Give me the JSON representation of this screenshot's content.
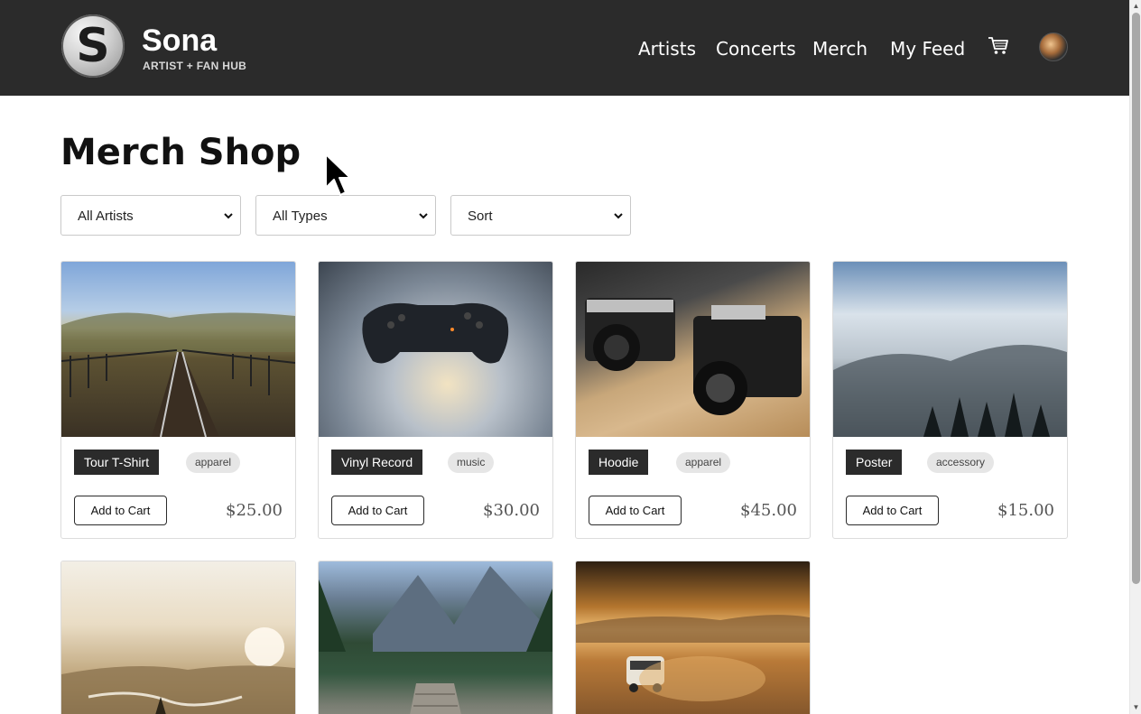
{
  "header": {
    "logo_letter": "S",
    "brand_name": "Sona",
    "brand_tagline": "ARTIST + FAN HUB",
    "nav": [
      {
        "label": "Artists"
      },
      {
        "label": "Concerts"
      },
      {
        "label": "Merch"
      },
      {
        "label": "My Feed"
      }
    ],
    "cart_icon": "cart-icon",
    "avatar_icon": "avatar"
  },
  "main": {
    "title": "Merch Shop",
    "filters": {
      "artist": "All Artists",
      "type": "All Types",
      "sort": "Sort"
    },
    "products": [
      {
        "name": "Tour T-Shirt",
        "category": "apparel",
        "price": "$25.00",
        "cta": "Add to Cart",
        "image": "railway-bridge-photo"
      },
      {
        "name": "Vinyl Record",
        "category": "music",
        "price": "$30.00",
        "cta": "Add to Cart",
        "image": "game-controller-photo"
      },
      {
        "name": "Hoodie",
        "category": "apparel",
        "price": "$45.00",
        "cta": "Add to Cart",
        "image": "vintage-cameras-photo"
      },
      {
        "name": "Poster",
        "category": "accessory",
        "price": "$15.00",
        "cta": "Add to Cart",
        "image": "misty-mountains-photo"
      }
    ],
    "more_products": [
      {
        "image": "sunset-valley-photo"
      },
      {
        "image": "mountain-lake-pier-photo"
      },
      {
        "image": "desert-van-photo"
      }
    ]
  },
  "colors": {
    "header_bg": "#2b2b2b",
    "tag_bg": "#2b2b2b",
    "category_bg": "#e6e6e6"
  }
}
